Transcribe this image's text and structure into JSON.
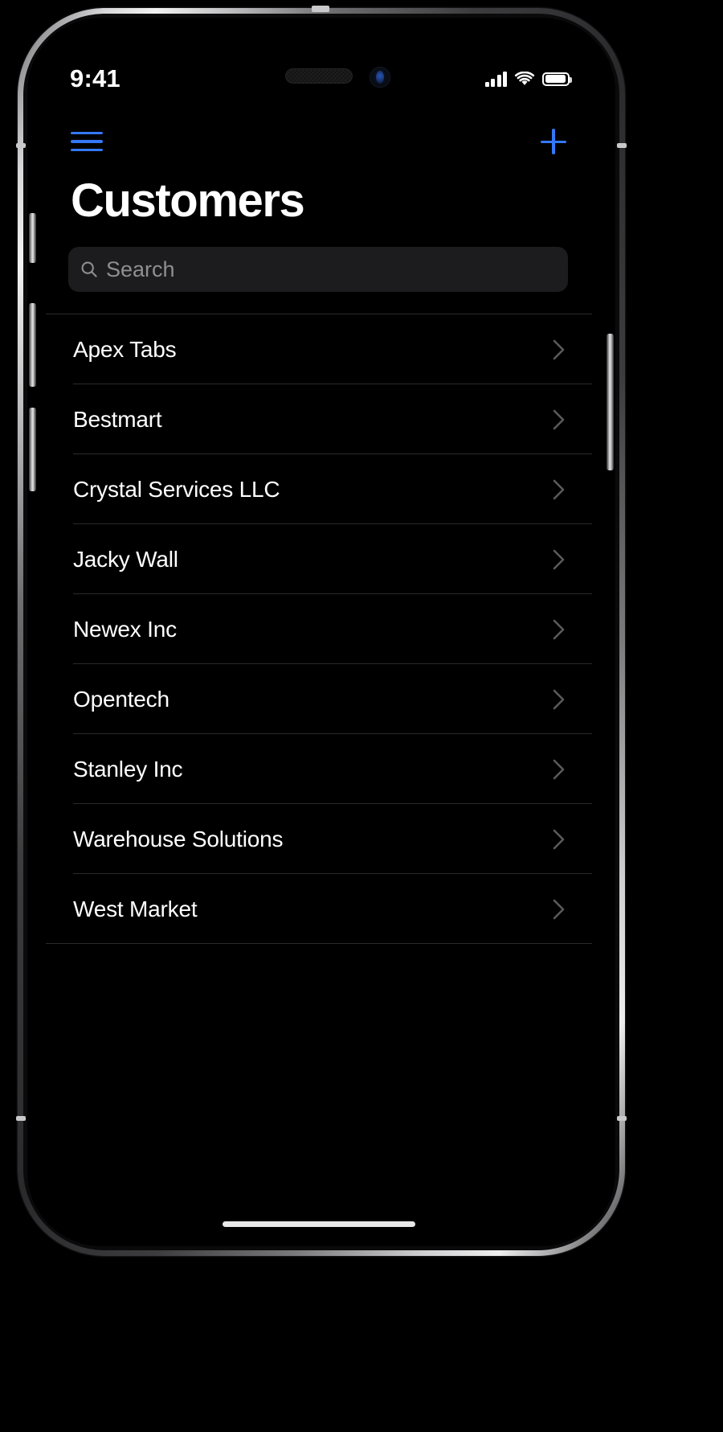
{
  "device": {
    "frame": "iphone",
    "buttons": [
      "silent-switch",
      "volume-up",
      "volume-down",
      "power"
    ]
  },
  "status_bar": {
    "time": "9:41",
    "cellular_icon": "cellular-bars-icon",
    "cellular_bars": 4,
    "wifi_icon": "wifi-icon",
    "battery_icon": "battery-icon",
    "battery_level": 85
  },
  "nav_bar": {
    "menu_icon": "hamburger-menu-icon",
    "add_icon": "plus-icon",
    "accent_color": "#3478f6"
  },
  "header": {
    "title": "Customers"
  },
  "search": {
    "icon": "search-icon",
    "placeholder": "Search",
    "value": ""
  },
  "list": {
    "chevron_icon": "chevron-right-icon",
    "items": [
      {
        "name": "Apex Tabs"
      },
      {
        "name": "Bestmart"
      },
      {
        "name": "Crystal Services LLC"
      },
      {
        "name": "Jacky Wall"
      },
      {
        "name": "Newex Inc"
      },
      {
        "name": "Opentech"
      },
      {
        "name": "Stanley Inc"
      },
      {
        "name": "Warehouse Solutions"
      },
      {
        "name": "West Market"
      }
    ]
  },
  "home_indicator": "home-indicator"
}
